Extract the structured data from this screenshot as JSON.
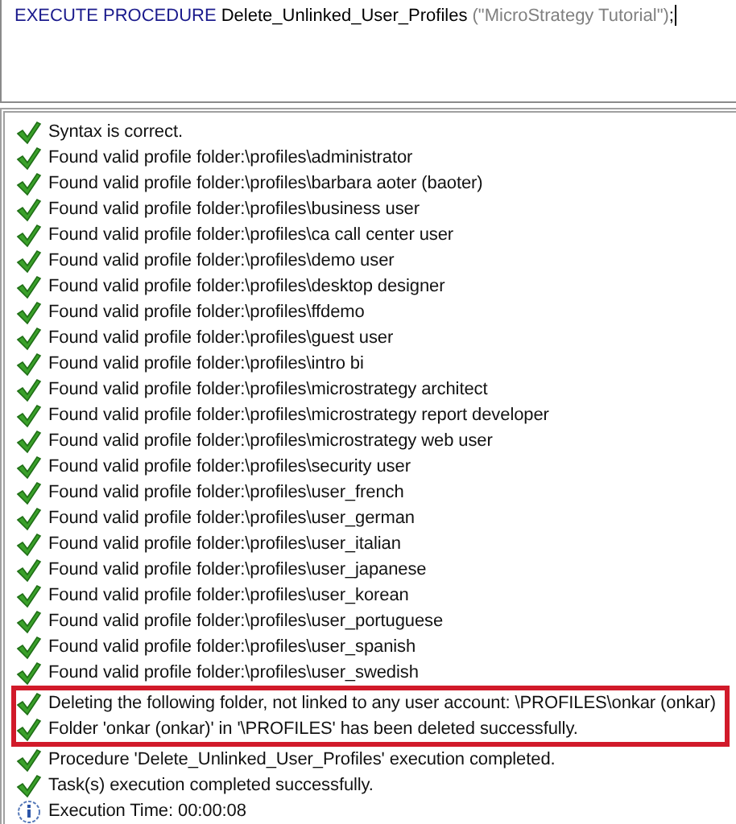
{
  "editor": {
    "tokens": [
      {
        "kind": "keyword",
        "text": "EXECUTE PROCEDURE"
      },
      {
        "kind": "plain",
        "text": " Delete_Unlinked_User_Profiles "
      },
      {
        "kind": "string",
        "text": "(\"MicroStrategy Tutorial\")"
      },
      {
        "kind": "plain",
        "text": ";"
      }
    ]
  },
  "output": {
    "lines": [
      {
        "kind": "success",
        "text": "Syntax is correct.",
        "highlighted": false
      },
      {
        "kind": "success",
        "text": "Found valid profile folder:\\profiles\\administrator",
        "highlighted": false
      },
      {
        "kind": "success",
        "text": "Found valid profile folder:\\profiles\\barbara aoter (baoter)",
        "highlighted": false
      },
      {
        "kind": "success",
        "text": "Found valid profile folder:\\profiles\\business user",
        "highlighted": false
      },
      {
        "kind": "success",
        "text": "Found valid profile folder:\\profiles\\ca call center user",
        "highlighted": false
      },
      {
        "kind": "success",
        "text": "Found valid profile folder:\\profiles\\demo user",
        "highlighted": false
      },
      {
        "kind": "success",
        "text": "Found valid profile folder:\\profiles\\desktop designer",
        "highlighted": false
      },
      {
        "kind": "success",
        "text": "Found valid profile folder:\\profiles\\ffdemo",
        "highlighted": false
      },
      {
        "kind": "success",
        "text": "Found valid profile folder:\\profiles\\guest user",
        "highlighted": false
      },
      {
        "kind": "success",
        "text": "Found valid profile folder:\\profiles\\intro bi",
        "highlighted": false
      },
      {
        "kind": "success",
        "text": "Found valid profile folder:\\profiles\\microstrategy architect",
        "highlighted": false
      },
      {
        "kind": "success",
        "text": "Found valid profile folder:\\profiles\\microstrategy report developer",
        "highlighted": false
      },
      {
        "kind": "success",
        "text": "Found valid profile folder:\\profiles\\microstrategy web user",
        "highlighted": false
      },
      {
        "kind": "success",
        "text": "Found valid profile folder:\\profiles\\security user",
        "highlighted": false
      },
      {
        "kind": "success",
        "text": "Found valid profile folder:\\profiles\\user_french",
        "highlighted": false
      },
      {
        "kind": "success",
        "text": "Found valid profile folder:\\profiles\\user_german",
        "highlighted": false
      },
      {
        "kind": "success",
        "text": "Found valid profile folder:\\profiles\\user_italian",
        "highlighted": false
      },
      {
        "kind": "success",
        "text": "Found valid profile folder:\\profiles\\user_japanese",
        "highlighted": false
      },
      {
        "kind": "success",
        "text": "Found valid profile folder:\\profiles\\user_korean",
        "highlighted": false
      },
      {
        "kind": "success",
        "text": "Found valid profile folder:\\profiles\\user_portuguese",
        "highlighted": false
      },
      {
        "kind": "success",
        "text": "Found valid profile folder:\\profiles\\user_spanish",
        "highlighted": false
      },
      {
        "kind": "success",
        "text": "Found valid profile folder:\\profiles\\user_swedish",
        "highlighted": false
      },
      {
        "kind": "success",
        "text": "Deleting the following folder, not linked to any user account: \\PROFILES\\onkar (onkar)",
        "highlighted": true
      },
      {
        "kind": "success",
        "text": "Folder 'onkar (onkar)' in '\\PROFILES' has been deleted successfully.",
        "highlighted": true
      },
      {
        "kind": "success",
        "text": "Procedure 'Delete_Unlinked_User_Profiles' execution completed.",
        "highlighted": false
      },
      {
        "kind": "success",
        "text": "Task(s) execution completed successfully.",
        "highlighted": false
      },
      {
        "kind": "info",
        "text": "Execution Time: 00:00:08",
        "highlighted": false
      }
    ]
  }
}
